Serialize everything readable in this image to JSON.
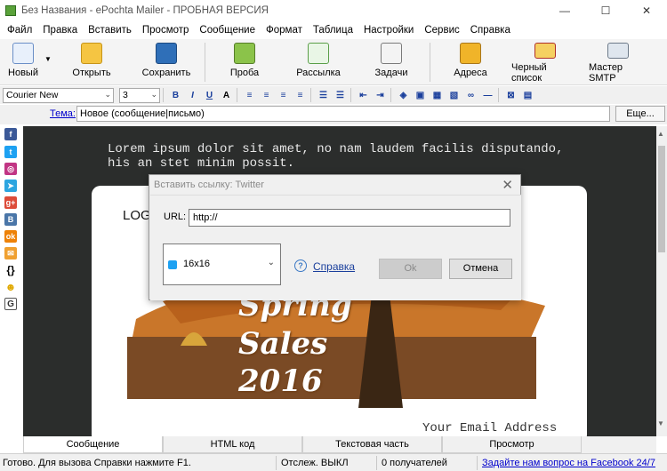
{
  "window": {
    "title": "Без Названия - ePochta Mailer - ПРОБНАЯ ВЕРСИЯ",
    "minimize": "—",
    "maximize": "☐",
    "close": "✕"
  },
  "menu": [
    "Файл",
    "Правка",
    "Вставить",
    "Просмотр",
    "Сообщение",
    "Формат",
    "Таблица",
    "Настройки",
    "Сервис",
    "Справка"
  ],
  "toolbar": {
    "new": "Новый",
    "open": "Открыть",
    "save": "Сохранить",
    "test": "Проба",
    "mailing": "Рассылка",
    "tasks": "Задачи",
    "addresses": "Адреса",
    "blacklist": "Черный список",
    "smtp_wizard": "Мастер SMTP"
  },
  "format": {
    "font": "Courier New",
    "size": "3"
  },
  "subject": {
    "label": "Тема:",
    "value": "Новое (сообщение|письмо)",
    "more": "Еще..."
  },
  "editor": {
    "lorem_line1": "Lorem ipsum dolor sit amet, no nam laudem facilis disputando,",
    "lorem_line2": "his an stet minim possit.",
    "logo": "LOGO",
    "spring": "Spring",
    "sales": "Sales",
    "year": "2016",
    "email_address": "Your Email Address"
  },
  "tabs": [
    "Сообщение",
    "HTML код",
    "Текстовая часть",
    "Просмотр"
  ],
  "status": {
    "ready": "Готово. Для вызова Справки нажмите F1.",
    "tracking": "Отслеж. ВЫКЛ",
    "recipients": "0 получателей",
    "facebook": "Задайте нам вопрос на Facebook 24/7"
  },
  "dialog": {
    "title": "Вставить ссылку: Twitter",
    "url_label": "URL:",
    "url_value": "http://",
    "icon_size": "16x16",
    "help": "Справка",
    "ok": "Ok",
    "cancel": "Отмена"
  },
  "colors": {
    "editor_bg": "#2b2d2c",
    "accent_orange": "#c9762a",
    "link_blue": "#0000cc",
    "twitter_blue": "#1da1f2"
  }
}
